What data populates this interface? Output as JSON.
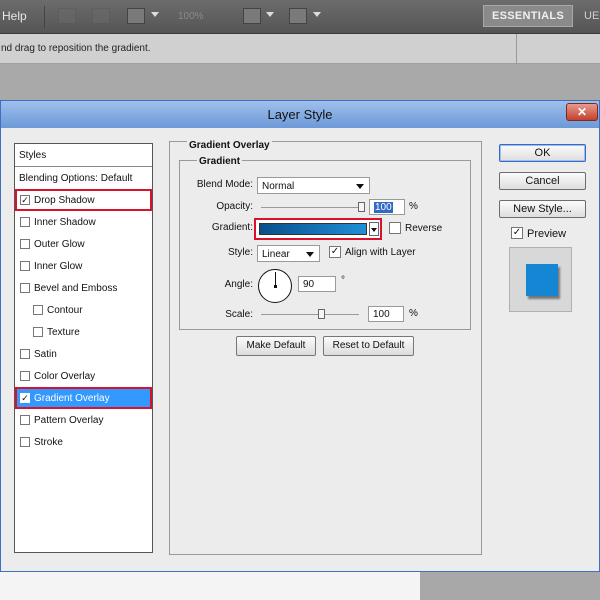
{
  "app": {
    "menu_help": "Help",
    "zoom_value": "100%",
    "workspace": "ESSENTIALS",
    "workspace_next": "UE",
    "hint": "nd drag to reposition the gradient."
  },
  "dialog": {
    "title": "Layer Style",
    "close_glyph": "✕",
    "styles_header": "Styles",
    "blending_options": "Blending Options: Default",
    "style_items": [
      {
        "label": "Drop Shadow",
        "checked": true
      },
      {
        "label": "Inner Shadow",
        "checked": false
      },
      {
        "label": "Outer Glow",
        "checked": false
      },
      {
        "label": "Inner Glow",
        "checked": false
      },
      {
        "label": "Bevel and Emboss",
        "checked": false
      },
      {
        "label": "Contour",
        "checked": false
      },
      {
        "label": "Texture",
        "checked": false
      },
      {
        "label": "Satin",
        "checked": false
      },
      {
        "label": "Color Overlay",
        "checked": false
      },
      {
        "label": "Gradient Overlay",
        "checked": true
      },
      {
        "label": "Pattern Overlay",
        "checked": false
      },
      {
        "label": "Stroke",
        "checked": false
      }
    ],
    "check_glyph": "✓",
    "group_title": "Gradient Overlay",
    "subgroup_title": "Gradient",
    "blend_mode_label": "Blend Mode:",
    "blend_mode_value": "Normal",
    "opacity_label": "Opacity:",
    "opacity_value": "100",
    "opacity_level": 1.0,
    "pct": "%",
    "gradient_label": "Gradient:",
    "gradient_colors": [
      "#0a4f8c",
      "#1e8fd8"
    ],
    "reverse_label": "Reverse",
    "reverse_checked": false,
    "style_label": "Style:",
    "style_value": "Linear",
    "align_label": "Align with Layer",
    "align_checked": true,
    "angle_label": "Angle:",
    "angle_value": "90",
    "degree": "°",
    "scale_label": "Scale:",
    "scale_value": "100",
    "scale_level": 0.62,
    "make_default": "Make Default",
    "reset_default": "Reset to Default",
    "ok": "OK",
    "cancel": "Cancel",
    "new_style": "New Style...",
    "preview_label": "Preview",
    "preview_checked": true,
    "preview_color": "#1586d4",
    "accent": "#3399ff",
    "highlight": "#d8122a"
  }
}
